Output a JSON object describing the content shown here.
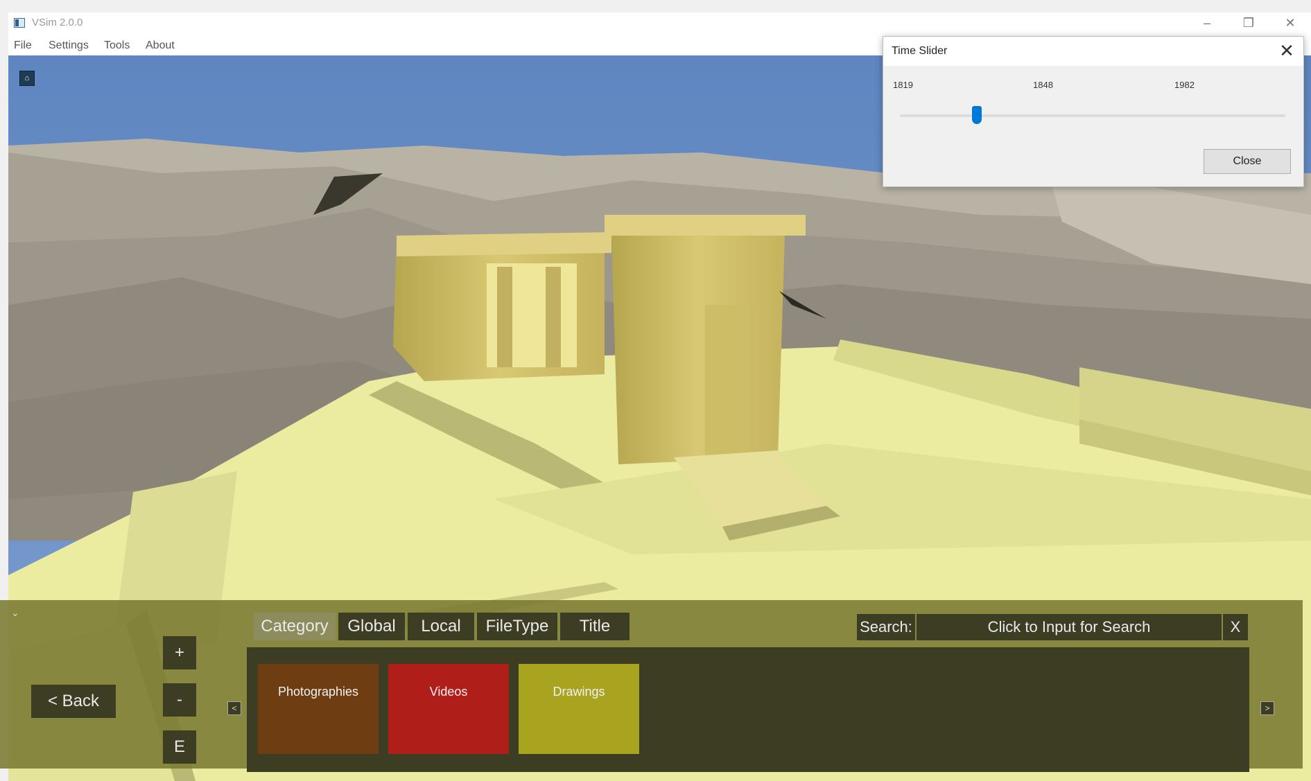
{
  "window": {
    "title": "VSim 2.0.0",
    "controls": {
      "minimize": "–",
      "maximize": "❐",
      "close": "✕"
    }
  },
  "menu": {
    "items": [
      "File",
      "Settings",
      "Tools",
      "About"
    ]
  },
  "time_slider": {
    "title": "Time Slider",
    "close_glyph": "✕",
    "ticks": [
      "1819",
      "1848",
      "1982"
    ],
    "slider_fraction": 0.2,
    "close_button": "Close"
  },
  "bottom_panel": {
    "collapse_glyph": "⌄",
    "back_button": "< Back",
    "zoom_in": "+",
    "zoom_out": "-",
    "e_button": "E",
    "tabs": [
      "Category",
      "Global",
      "Local",
      "FileType",
      "Title"
    ],
    "active_tab": "Category",
    "search": {
      "label": "Search:",
      "placeholder": "Click to Input for Search",
      "clear": "X"
    },
    "cards": [
      {
        "label": "Photographies",
        "color": "#6e3e12"
      },
      {
        "label": "Videos",
        "color": "#b01e1a"
      },
      {
        "label": "Drawings",
        "color": "#a8a420"
      }
    ],
    "prev_arrow": "<",
    "next_arrow": ">"
  },
  "colors": {
    "sky": "#6b8fc4",
    "sand": "#ececa0",
    "panel": "#7a7a32",
    "panel_dark": "#3d3d24",
    "accent": "#0078d7"
  }
}
